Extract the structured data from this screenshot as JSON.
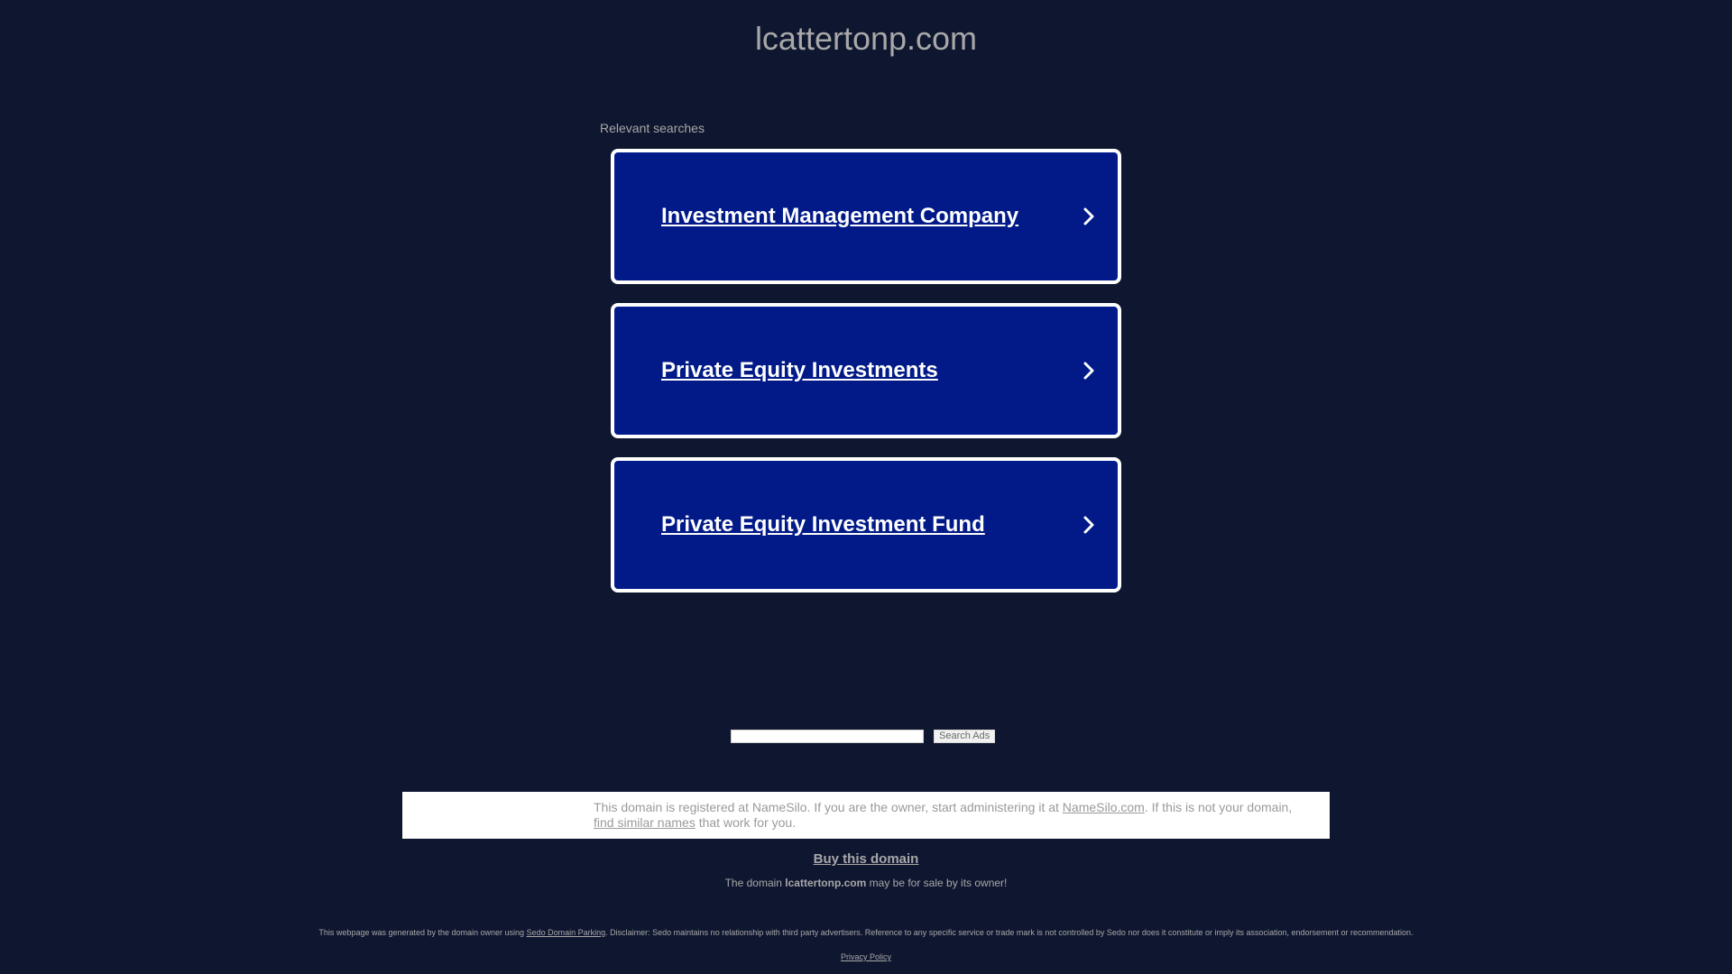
{
  "site": {
    "title": "lcattertonp.com"
  },
  "searches": {
    "label": "Relevant searches",
    "items": [
      {
        "label": "Investment Management Company"
      },
      {
        "label": "Private Equity Investments"
      },
      {
        "label": "Private Equity Investment Fund"
      }
    ]
  },
  "search": {
    "input_value": "",
    "button_label": "Search Ads"
  },
  "notice": {
    "text_1": "This domain is registered at NameSilo. If you are the owner, start administering it at ",
    "link_1": "NameSilo.com",
    "text_2": ". If this is not your domain, ",
    "link_2": "find similar names",
    "text_3": " that work for you."
  },
  "sale": {
    "buy_label": "Buy this domain",
    "prefix": "The domain ",
    "domain": "lcattertonp.com",
    "suffix": " may be for sale by its owner!"
  },
  "footer": {
    "disclaimer_prefix": "This webpage was generated by the domain owner using ",
    "disclaimer_link": "Sedo Domain Parking",
    "disclaimer_suffix": ". Disclaimer: Sedo maintains no relationship with third party advertisers. Reference to any specific service or trade mark is not controlled by Sedo nor does it constitute or imply its association, endorsement or recommendation.",
    "privacy_label": "Privacy Policy"
  },
  "colors": {
    "background": "#0f1730",
    "ad_block": "#011a88",
    "ad_border": "#ffffff",
    "muted_text": "#a8a8a8"
  },
  "icons": {
    "ad_arrow": "chevron-right-icon"
  }
}
